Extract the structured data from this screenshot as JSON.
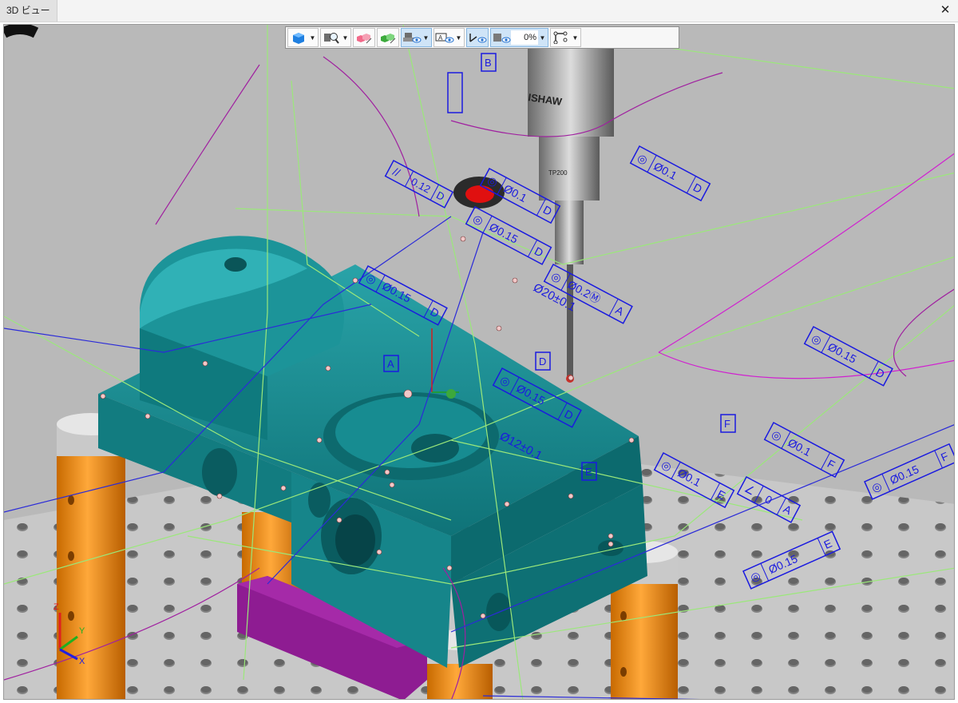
{
  "window": {
    "tab_title": "3D ビュー",
    "close_glyph": "✕"
  },
  "toolbar": {
    "buttons": [
      {
        "icon": "solid-cube-icon"
      },
      {
        "icon": "view-magnify-icon"
      },
      {
        "icon": "pink-cubes-hide-icon"
      },
      {
        "icon": "green-cubes-hide-icon"
      },
      {
        "icon": "probe-visibility-icon"
      },
      {
        "icon": "annotation-visibility-icon"
      },
      {
        "icon": "coordinate-visibility-icon"
      },
      {
        "icon": "fixture-visibility-icon"
      },
      {
        "icon": "path-visibility-icon"
      }
    ],
    "transparency_value": "0%"
  },
  "probe": {
    "brand_text": "ISHAW",
    "model_text": "TP200"
  },
  "annotations": {
    "fcf_parallel": {
      "symbol": "//",
      "value": "0.12",
      "datum": "D"
    },
    "fcf_top_a": {
      "symbol": "◎",
      "value": "Ø0.1",
      "datum": "D"
    },
    "fcf_top_b": {
      "symbol": "◎",
      "value": "Ø0.15",
      "datum": "D"
    },
    "fcf_top_c": {
      "symbol": "◎",
      "value": "Ø0.1",
      "datum": "D"
    },
    "fcf_position": {
      "symbol": "◎",
      "value": "Ø0.2Ⓜ",
      "datum": "A"
    },
    "fcf_right_d": {
      "symbol": "◎",
      "value": "Ø0.15",
      "datum": "D"
    },
    "fcf_mid_left": {
      "symbol": "◎",
      "value": "Ø0.15",
      "datum": "D"
    },
    "fcf_center": {
      "symbol": "◎",
      "value": "Ø0.15",
      "datum": "D"
    },
    "fcf_right_f": {
      "symbol": "◎",
      "value": "Ø0.1",
      "datum": "F"
    },
    "fcf_e": {
      "symbol": "◎",
      "value": "Ø0.1",
      "datum": "E"
    },
    "fcf_angle": {
      "symbol": "∠",
      "value": "0",
      "datum": "A"
    },
    "fcf_far_f": {
      "symbol": "◎",
      "value": "Ø0.15",
      "datum": "F"
    },
    "fcf_bottom_e": {
      "symbol": "◎",
      "value": "Ø0.15",
      "datum": "E"
    },
    "dim_upper": "Ø20±0.1",
    "dim_lower": "Ø12±0.1",
    "datum_a": "A",
    "datum_b": "B",
    "datum_d": "D",
    "datum_f": "F",
    "datum_e": "E"
  },
  "axis_triad": {
    "x": "X",
    "y": "Y",
    "z": "Z"
  },
  "colors": {
    "viewport_bg": "#b7b7b7",
    "part": "#1a8a8e",
    "part_dark": "#0d5f63",
    "fixture_orange": "#ee8a12",
    "fixture_purple": "#8a1a8e",
    "annotation_blue": "#1a1ae0",
    "path_green": "#9be87a",
    "path_magenta": "#c020c0"
  }
}
